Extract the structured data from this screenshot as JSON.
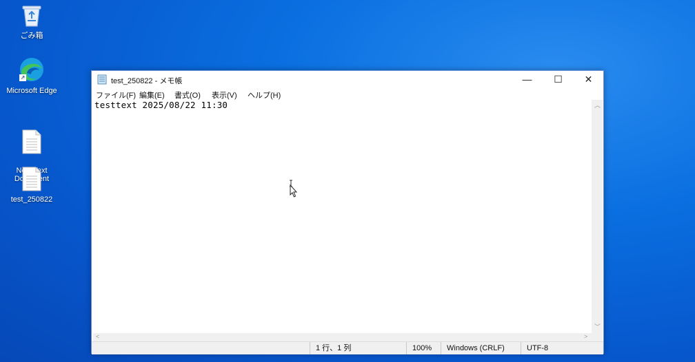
{
  "desktop": {
    "icons": [
      {
        "label": "ごみ箱",
        "icon": "recycle-bin-icon"
      },
      {
        "label": "Microsoft Edge",
        "icon": "edge-icon"
      },
      {
        "label": "New Text\nDocument",
        "icon": "text-file-icon"
      },
      {
        "label": "test_250822",
        "icon": "text-file-icon"
      }
    ]
  },
  "window": {
    "title": "test_250822 - メモ帳",
    "controls": {
      "minimize": "—",
      "maximize": "☐",
      "close": "✕"
    },
    "menu": [
      "ファイル(F)",
      "編集(E)",
      "書式(O)",
      "表示(V)",
      "ヘルプ(H)"
    ],
    "content": "testtext 2025/08/22 11:30",
    "status": {
      "position": "1 行、1 列",
      "zoom": "100%",
      "line_ending": "Windows (CRLF)",
      "encoding": "UTF-8"
    }
  },
  "colors": {
    "desktop_accent": "#0a6fe0",
    "window_border": "#6b8fd6"
  }
}
